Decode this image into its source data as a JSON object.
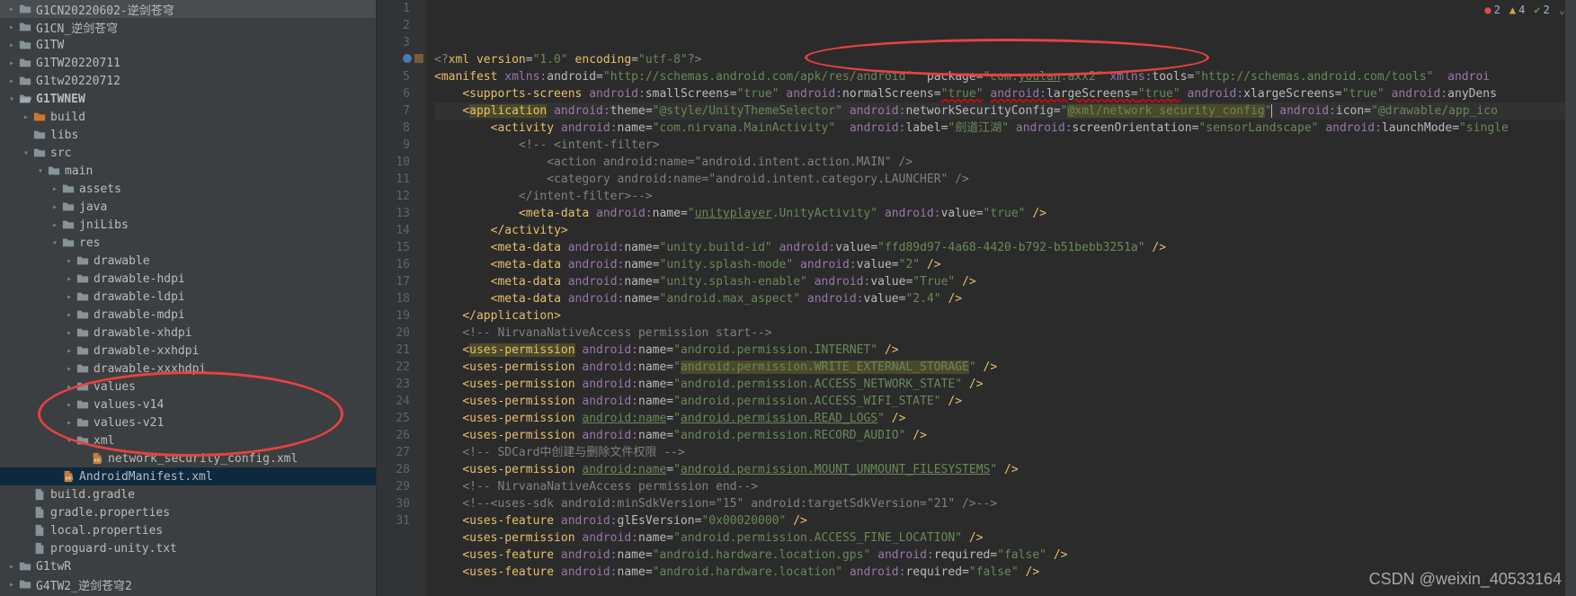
{
  "sidebar": {
    "items": [
      {
        "indent": 0,
        "chevron": "right",
        "icon": "folder",
        "label": "G1CN20220602-逆剑苍穹"
      },
      {
        "indent": 0,
        "chevron": "right",
        "icon": "folder",
        "label": "G1CN_逆剑苍穹"
      },
      {
        "indent": 0,
        "chevron": "right",
        "icon": "folder",
        "label": "G1TW"
      },
      {
        "indent": 0,
        "chevron": "right",
        "icon": "folder",
        "label": "G1TW20220711"
      },
      {
        "indent": 0,
        "chevron": "right",
        "icon": "folder",
        "label": "G1tw20220712"
      },
      {
        "indent": 0,
        "chevron": "down",
        "icon": "folder-open",
        "label": "G1TWNEW",
        "bold": true
      },
      {
        "indent": 1,
        "chevron": "right",
        "icon": "folder-build",
        "label": "build"
      },
      {
        "indent": 1,
        "chevron": "",
        "icon": "folder",
        "label": "libs"
      },
      {
        "indent": 1,
        "chevron": "down",
        "icon": "folder",
        "label": "src"
      },
      {
        "indent": 2,
        "chevron": "down",
        "icon": "folder",
        "label": "main"
      },
      {
        "indent": 3,
        "chevron": "right",
        "icon": "folder",
        "label": "assets"
      },
      {
        "indent": 3,
        "chevron": "right",
        "icon": "folder",
        "label": "java"
      },
      {
        "indent": 3,
        "chevron": "right",
        "icon": "folder",
        "label": "jniLibs"
      },
      {
        "indent": 3,
        "chevron": "down",
        "icon": "folder",
        "label": "res"
      },
      {
        "indent": 4,
        "chevron": "right",
        "icon": "folder",
        "label": "drawable"
      },
      {
        "indent": 4,
        "chevron": "right",
        "icon": "folder",
        "label": "drawable-hdpi"
      },
      {
        "indent": 4,
        "chevron": "right",
        "icon": "folder",
        "label": "drawable-ldpi"
      },
      {
        "indent": 4,
        "chevron": "right",
        "icon": "folder",
        "label": "drawable-mdpi"
      },
      {
        "indent": 4,
        "chevron": "right",
        "icon": "folder",
        "label": "drawable-xhdpi"
      },
      {
        "indent": 4,
        "chevron": "right",
        "icon": "folder",
        "label": "drawable-xxhdpi"
      },
      {
        "indent": 4,
        "chevron": "right",
        "icon": "folder",
        "label": "drawable-xxxhdpi"
      },
      {
        "indent": 4,
        "chevron": "right",
        "icon": "folder",
        "label": "values"
      },
      {
        "indent": 4,
        "chevron": "right",
        "icon": "folder",
        "label": "values-v14"
      },
      {
        "indent": 4,
        "chevron": "right",
        "icon": "folder",
        "label": "values-v21"
      },
      {
        "indent": 4,
        "chevron": "down",
        "icon": "folder",
        "label": "xml"
      },
      {
        "indent": 5,
        "chevron": "",
        "icon": "xml",
        "label": "network_security_config.xml"
      },
      {
        "indent": 3,
        "chevron": "",
        "icon": "xml",
        "label": "AndroidManifest.xml",
        "selected": true
      },
      {
        "indent": 1,
        "chevron": "",
        "icon": "file",
        "label": "build.gradle"
      },
      {
        "indent": 1,
        "chevron": "",
        "icon": "file",
        "label": "gradle.properties"
      },
      {
        "indent": 1,
        "chevron": "",
        "icon": "file",
        "label": "local.properties"
      },
      {
        "indent": 1,
        "chevron": "",
        "icon": "file",
        "label": "proguard-unity.txt"
      },
      {
        "indent": 0,
        "chevron": "right",
        "icon": "folder",
        "label": "G1twR"
      },
      {
        "indent": 0,
        "chevron": "right",
        "icon": "folder",
        "label": "G4TW2_逆剑苍穹2"
      }
    ]
  },
  "status": {
    "errors": "2",
    "warnings": "4",
    "weak": "2"
  },
  "gutter": {
    "start": 1,
    "end": 31,
    "active": 4
  },
  "code": {
    "lines": [
      {
        "n": 1,
        "html": "<span class='tok-xml'>&lt;?</span><span class='tok-tag'>xml version</span><span class='tok-attr'>=</span><span class='tok-str'>\"1.0\"</span> <span class='tok-tag'>encoding</span><span class='tok-attr'>=</span><span class='tok-str'>\"utf-8\"</span><span class='tok-xml'>?&gt;</span>"
      },
      {
        "n": 2,
        "html": "<span class='tok-bracket'>&lt;</span><span class='tok-tag'>manifest</span> <span class='tok-ns'>xmlns:</span><span class='tok-attr'>android=</span><span class='tok-str'>\"http://schemas.android.com/apk/res/android\"</span>  <span class='tok-attr'>package=</span><span class='tok-str'>\"com.<span class='tok-str-link'>youlan</span>.axx2\"</span> <span class='tok-ns'>xmlns:</span><span class='tok-attr'>tools=</span><span class='tok-str'>\"http://schemas.android.com/tools\"</span>  <span class='tok-ns'>androi</span>"
      },
      {
        "n": 3,
        "html": "    <span class='tok-bracket'>&lt;</span><span class='tok-tag'>supports-screens</span> <span class='tok-ns'>android:</span><span class='tok-attr'>smallScreens=</span><span class='tok-str'>\"true\"</span> <span class='tok-ns'>android:</span><span class='tok-attr'>normalScreens=</span><span class='tok-str tok-red-line'>\"true\"</span> <span class='tok-ns tok-red-line'>android:</span><span class='tok-attr tok-red-line'>largeScreens=</span><span class='tok-str tok-red-line'>\"true\"</span> <span class='tok-ns'>android:</span><span class='tok-attr'>xlargeScreens=</span><span class='tok-str'>\"true\"</span> <span class='tok-ns'>android:</span><span class='tok-attr'>anyDens</span>"
      },
      {
        "n": 4,
        "html": "    <span class='tok-bracket'>&lt;</span><span class='tok-tag tok-yellow-bg'>application</span> <span class='tok-ns'>android:</span><span class='tok-attr'>theme=</span><span class='tok-str'>\"@style/UnityThemeSelector\"</span> <span class='tok-ns'>android:</span><span class='tok-attr'>networkSecurityConfig=</span><span class='tok-str'>\"<span class='tok-yellow-bg'>@xml/network_security_config</span>\"</span><span class='cursor'></span> <span class='tok-ns'>android:</span><span class='tok-attr'>icon=</span><span class='tok-str'>\"@drawable/app_ico</span>"
      },
      {
        "n": 5,
        "html": "        <span class='tok-bracket'>&lt;</span><span class='tok-tag'>activity</span> <span class='tok-ns'>android:</span><span class='tok-attr'>name=</span><span class='tok-str'>\"com.nirvana.MainActivity\"</span>  <span class='tok-ns'>android:</span><span class='tok-attr'>label=</span><span class='tok-str'>\"劍道江湖\"</span> <span class='tok-ns'>android:</span><span class='tok-attr'>screenOrientation=</span><span class='tok-str'>\"sensorLandscape\"</span> <span class='tok-ns'>android:</span><span class='tok-attr'>launchMode=</span><span class='tok-str'>\"single</span>"
      },
      {
        "n": 6,
        "html": "            <span class='tok-comment'>&lt;!-- &lt;intent-filter&gt;</span>"
      },
      {
        "n": 7,
        "html": "<span class='tok-comment'>                &lt;action android:name=\"android.intent.action.MAIN\" /&gt;</span>"
      },
      {
        "n": 8,
        "html": "<span class='tok-comment'>                &lt;category android:name=\"android.intent.category.LAUNCHER\" /&gt;</span>"
      },
      {
        "n": 9,
        "html": "<span class='tok-comment'>            &lt;/intent-filter&gt;--&gt;</span>"
      },
      {
        "n": 10,
        "html": "            <span class='tok-bracket'>&lt;</span><span class='tok-tag'>meta-data</span> <span class='tok-ns'>android:</span><span class='tok-attr'>name=</span><span class='tok-str'>\"<span class='tok-str-link'>unityplayer</span>.UnityActivity\"</span> <span class='tok-ns'>android:</span><span class='tok-attr'>value=</span><span class='tok-str'>\"true\"</span> <span class='tok-bracket'>/&gt;</span>"
      },
      {
        "n": 11,
        "html": "        <span class='tok-bracket'>&lt;/</span><span class='tok-tag'>activity</span><span class='tok-bracket'>&gt;</span>"
      },
      {
        "n": 12,
        "html": "        <span class='tok-bracket'>&lt;</span><span class='tok-tag'>meta-data</span> <span class='tok-ns'>android:</span><span class='tok-attr'>name=</span><span class='tok-str'>\"unity.build-id\"</span> <span class='tok-ns'>android:</span><span class='tok-attr'>value=</span><span class='tok-str'>\"ffd89d97-4a68-4420-b792-b51bebb3251a\"</span> <span class='tok-bracket'>/&gt;</span>"
      },
      {
        "n": 13,
        "html": "        <span class='tok-bracket'>&lt;</span><span class='tok-tag'>meta-data</span> <span class='tok-ns'>android:</span><span class='tok-attr'>name=</span><span class='tok-str'>\"unity.splash-mode\"</span> <span class='tok-ns'>android:</span><span class='tok-attr'>value=</span><span class='tok-str'>\"2\"</span> <span class='tok-bracket'>/&gt;</span>"
      },
      {
        "n": 14,
        "html": "        <span class='tok-bracket'>&lt;</span><span class='tok-tag'>meta-data</span> <span class='tok-ns'>android:</span><span class='tok-attr'>name=</span><span class='tok-str'>\"unity.splash-enable\"</span> <span class='tok-ns'>android:</span><span class='tok-attr'>value=</span><span class='tok-str'>\"True\"</span> <span class='tok-bracket'>/&gt;</span>"
      },
      {
        "n": 15,
        "html": "        <span class='tok-bracket'>&lt;</span><span class='tok-tag'>meta-data</span> <span class='tok-ns'>android:</span><span class='tok-attr'>name=</span><span class='tok-str'>\"android.max_aspect\"</span> <span class='tok-ns'>android:</span><span class='tok-attr'>value=</span><span class='tok-str'>\"2.4\"</span> <span class='tok-bracket'>/&gt;</span>"
      },
      {
        "n": 16,
        "html": "    <span class='tok-bracket'>&lt;/</span><span class='tok-tag'>application</span><span class='tok-bracket'>&gt;</span>"
      },
      {
        "n": 17,
        "html": "    <span class='tok-comment'>&lt;!-- NirvanaNativeAccess permission start--&gt;</span>"
      },
      {
        "n": 18,
        "html": "    <span class='tok-bracket'>&lt;</span><span class='tok-tag tok-yellow-bg'>uses-permission</span> <span class='tok-ns'>android:</span><span class='tok-attr'>name=</span><span class='tok-str'>\"android.permission.INTERNET\"</span> <span class='tok-bracket'>/&gt;</span>"
      },
      {
        "n": 19,
        "html": "    <span class='tok-bracket'>&lt;</span><span class='tok-tag'>uses-permission</span> <span class='tok-ns'>android:</span><span class='tok-attr'>name=</span><span class='tok-str'>\"<span class='tok-yellow-bg'>android.permission.WRITE_EXTERNAL_STORAGE</span>\"</span> <span class='tok-bracket'>/&gt;</span>"
      },
      {
        "n": 20,
        "html": "    <span class='tok-bracket'>&lt;</span><span class='tok-tag'>uses-permission</span> <span class='tok-ns'>android:</span><span class='tok-attr'>name=</span><span class='tok-str'>\"android.permission.ACCESS_NETWORK_STATE\"</span> <span class='tok-bracket'>/&gt;</span>"
      },
      {
        "n": 21,
        "html": "    <span class='tok-bracket'>&lt;</span><span class='tok-tag'>uses-permission</span> <span class='tok-ns'>android:</span><span class='tok-attr'>name=</span><span class='tok-str'>\"android.permission.ACCESS_WIFI_STATE\"</span> <span class='tok-bracket'>/&gt;</span>"
      },
      {
        "n": 22,
        "html": "    <span class='tok-bracket'>&lt;</span><span class='tok-tag'>uses-permission</span> <span class='tok-ns'><span class='tok-str-link'>android:</span></span><span class='tok-attr'><span class='tok-str-link'>name</span>=</span><span class='tok-str'>\"<span class='tok-str-link'>android.permission.READ_LOGS</span>\"</span> <span class='tok-bracket'>/&gt;</span>"
      },
      {
        "n": 23,
        "html": "    <span class='tok-bracket'>&lt;</span><span class='tok-tag'>uses-permission</span> <span class='tok-ns'>android:</span><span class='tok-attr'>name=</span><span class='tok-str'>\"android.permission.RECORD_AUDIO\"</span> <span class='tok-bracket'>/&gt;</span>"
      },
      {
        "n": 24,
        "html": "    <span class='tok-comment'>&lt;!-- SDCard中创建与删除文件权限 --&gt;</span>"
      },
      {
        "n": 25,
        "html": "    <span class='tok-bracket'>&lt;</span><span class='tok-tag'>uses-permission</span> <span class='tok-ns'><span class='tok-str-link'>android:</span></span><span class='tok-attr'><span class='tok-str-link'>name</span>=</span><span class='tok-str'>\"<span class='tok-str-link'>android.permission.MOUNT_UNMOUNT_FILESYSTEMS</span>\"</span> <span class='tok-bracket'>/&gt;</span>"
      },
      {
        "n": 26,
        "html": "    <span class='tok-comment'>&lt;!-- NirvanaNativeAccess permission end--&gt;</span>"
      },
      {
        "n": 27,
        "html": "    <span class='tok-comment'>&lt;!--&lt;uses-sdk android:minSdkVersion=\"15\" android:targetSdkVersion=\"21\" /&gt;--&gt;</span>"
      },
      {
        "n": 28,
        "html": "    <span class='tok-bracket'>&lt;</span><span class='tok-tag'>uses-feature</span> <span class='tok-ns'>android:</span><span class='tok-attr'>glEsVersion=</span><span class='tok-str'>\"0x00020000\"</span> <span class='tok-bracket'>/&gt;</span>"
      },
      {
        "n": 29,
        "html": "    <span class='tok-bracket'>&lt;</span><span class='tok-tag'>uses-permission</span> <span class='tok-ns'>android:</span><span class='tok-attr'>name=</span><span class='tok-str'>\"android.permission.ACCESS_FINE_LOCATION\"</span> <span class='tok-bracket'>/&gt;</span>"
      },
      {
        "n": 30,
        "html": "    <span class='tok-bracket'>&lt;</span><span class='tok-tag'>uses-feature</span> <span class='tok-ns'>android:</span><span class='tok-attr'>name=</span><span class='tok-str'>\"android.hardware.location.gps\"</span> <span class='tok-ns'>android:</span><span class='tok-attr'>required=</span><span class='tok-str'>\"false\"</span> <span class='tok-bracket'>/&gt;</span>"
      },
      {
        "n": 31,
        "html": "    <span class='tok-bracket'>&lt;</span><span class='tok-tag'>uses-feature</span> <span class='tok-ns'>android:</span><span class='tok-attr'>name=</span><span class='tok-str'>\"android.hardware.location\"</span> <span class='tok-ns'>android:</span><span class='tok-attr'>required=</span><span class='tok-str'>\"false\"</span> <span class='tok-bracket'>/&gt;</span>"
      }
    ]
  },
  "watermark": "CSDN @weixin_40533164"
}
